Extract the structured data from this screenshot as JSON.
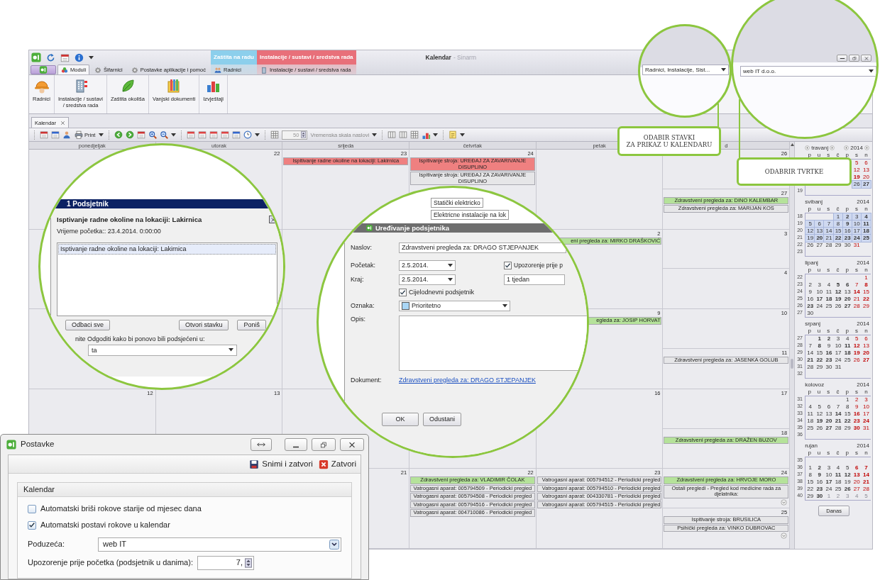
{
  "window": {
    "title": "Kalendar",
    "subtitle": "- Sinarm"
  },
  "ribbon_tabs": [
    {
      "label": "Moduli",
      "kind": "modules",
      "selected": true
    },
    {
      "label": "Šifarnici",
      "kind": "codebooks",
      "selected": false
    },
    {
      "label": "Postavke aplikacije i pomoć",
      "kind": "settings",
      "selected": false
    }
  ],
  "context_groups": [
    {
      "label": "Zaštita na radu",
      "color": "#8ccfec",
      "tab": {
        "label": "Radnici",
        "kind": "workers",
        "selected": false
      }
    },
    {
      "label": "Instalacije / sustavi / sredstva rada",
      "color": "#e8707a",
      "tab": {
        "label": "Instalacije / sustavi / sredstva rada",
        "kind": "installations",
        "selected": false
      }
    }
  ],
  "ribbon_buttons": [
    {
      "label": "Radnici",
      "kind": "workers"
    },
    {
      "label": "Instalacije / sustavi / sredstva rada",
      "kind": "installations"
    },
    {
      "label": "Zaštita okoliša",
      "kind": "environment"
    },
    {
      "label": "Vanjski dokumenti",
      "kind": "documents"
    },
    {
      "label": "Izvještaji",
      "kind": "reports"
    }
  ],
  "document_tabs": [
    {
      "label": "Kalendar",
      "selected": true
    }
  ],
  "toolbar": {
    "print": "Print",
    "scale_value": "50",
    "scale_label": "Vremenska skala naslovi"
  },
  "calendar": {
    "day_headers": [
      "ponedjeljak",
      "utorak",
      "srijeda",
      "četvrtak",
      "petak",
      "d"
    ],
    "weeks": [
      {
        "cells": [
          {
            "kind": "day"
          },
          {
            "kind": "day",
            "day": "22"
          },
          {
            "kind": "day",
            "day": "23",
            "events": [
              {
                "text": "Ispitivanje radne okoline na lokaciji: Lakirnica",
                "color": "#ef8080"
              }
            ]
          },
          {
            "kind": "day",
            "day": "24",
            "events": [
              {
                "text": "Ispitivanje stroja: UREĐAJ ZA ZAVARIVANJE DISUPLINO",
                "color": "#ef8080"
              },
              {
                "text": "Ispitivanje stroja: UREĐAJ ZA ZAVARIVANJE DISUPLINO",
                "color": "#e6e6e8"
              }
            ]
          },
          {
            "kind": "day"
          },
          {
            "kind": "weekend",
            "days": [
              {
                "day": "26"
              },
              {
                "day": "27",
                "events": [
                  {
                    "text": "Zdravstveni pregleda za: DINO KALEMBAR",
                    "color": "#b5e29a"
                  },
                  {
                    "text": "Zdravstveni pregleda za: MARIJAN KOS",
                    "color": "#e6e6e8"
                  }
                ]
              }
            ]
          }
        ]
      },
      {
        "cells": [
          {
            "kind": "day"
          },
          {
            "kind": "day"
          },
          {
            "kind": "day"
          },
          {
            "kind": "day"
          },
          {
            "kind": "day",
            "day": "2",
            "events": [
              {
                "text": "eni pregleda za: MIRKO DRAŠKOVIĆ",
                "color": "#b5e29a"
              }
            ]
          },
          {
            "kind": "weekend",
            "days": [
              {
                "day": "3"
              },
              {
                "day": "4"
              }
            ]
          }
        ]
      },
      {
        "cells": [
          {
            "kind": "day"
          },
          {
            "kind": "day"
          },
          {
            "kind": "day"
          },
          {
            "kind": "day"
          },
          {
            "kind": "day",
            "day": "9",
            "events": [
              {
                "text": "egleda za: JOSIP HORVAT",
                "color": "#b5e29a"
              }
            ]
          },
          {
            "kind": "weekend",
            "days": [
              {
                "day": "10"
              },
              {
                "day": "11",
                "events": [
                  {
                    "text": "Zdravstveni pregleda za: JASENKA GOLUB",
                    "color": "#e6e6e8"
                  }
                ]
              }
            ]
          }
        ]
      },
      {
        "cells": [
          {
            "kind": "day",
            "day": "12"
          },
          {
            "kind": "day",
            "day": "13"
          },
          {
            "kind": "day"
          },
          {
            "kind": "day"
          },
          {
            "kind": "day",
            "day": "16"
          },
          {
            "kind": "weekend",
            "days": [
              {
                "day": "17"
              },
              {
                "day": "18",
                "events": [
                  {
                    "text": "Zdravstveni pregleda za: DRAŽEN BUZOV",
                    "color": "#b5e29a"
                  }
                ]
              }
            ]
          }
        ]
      },
      {
        "cells": [
          {
            "kind": "day"
          },
          {
            "kind": "day"
          },
          {
            "kind": "day",
            "day": "21"
          },
          {
            "kind": "day",
            "day": "22",
            "events": [
              {
                "text": "Zdravstveni pregleda za: VLADIMIR ČOLAK",
                "color": "#b5e29a"
              },
              {
                "text": "Vatrogasni aparat: 005794509 - Periodicki pregled",
                "color": "#e6e6e8"
              },
              {
                "text": "Vatrogasni aparat: 005794508 - Periodicki pregled",
                "color": "#e6e6e8"
              },
              {
                "text": "Vatrogasni aparat: 005794516 - Periodicki pregled",
                "color": "#e6e6e8"
              },
              {
                "text": "Vatrogasni aparat: 004710086 - Periodicki pregled",
                "color": "#e6e6e8"
              }
            ]
          },
          {
            "kind": "day",
            "day": "23",
            "events": [
              {
                "text": "Vatrogasni aparat: 005794512 - Periodicki pregled",
                "color": "#e6e6e8"
              },
              {
                "text": "Vatrogasni aparat: 005794510 - Periodicki pregled",
                "color": "#e6e6e8"
              },
              {
                "text": "Vatrogasni aparat: 004330781 - Periodicki pregled",
                "color": "#e6e6e8"
              },
              {
                "text": "Vatrogasni aparat: 005794515 - Periodicki pregled",
                "color": "#e6e6e8"
              }
            ]
          },
          {
            "kind": "weekend",
            "days": [
              {
                "day": "24",
                "more": true,
                "events": [
                  {
                    "text": "Zdravstveni pregleda za: HRVOJE MORO",
                    "color": "#b5e29a"
                  },
                  {
                    "text": "Ostali pregledi - Pregled kod medicine rada za djelatnika:",
                    "color": "#e6e6e8"
                  }
                ]
              },
              {
                "day": "25",
                "more": true,
                "events": [
                  {
                    "text": "Ispitivanje stroja: BRUSILICA",
                    "color": "#e6e6e8"
                  },
                  {
                    "text": "Psihički pregleda za: VINKO DUBROVAC",
                    "color": "#e6e6e8"
                  }
                ]
              }
            ]
          }
        ]
      }
    ]
  },
  "mini_calendars": [
    {
      "name": "travanj",
      "year": "2014",
      "navigation": true,
      "weekdays": [
        "p",
        "u",
        "s",
        "č",
        "p",
        "s",
        "n"
      ],
      "weeks": [
        {
          "kind": "tail",
          "days": [
            "5",
            "6"
          ],
          "bold": [
            false,
            false
          ],
          "selected": false
        },
        {
          "kind": "tail",
          "days": [
            "12",
            "13"
          ],
          "bold": [
            false,
            false
          ],
          "selected": false
        },
        {
          "kind": "tail",
          "days": [
            "19",
            "20"
          ],
          "bold": [
            true,
            false
          ],
          "selected": false
        },
        {
          "kind": "tail",
          "days": [
            "26",
            "27"
          ],
          "bold": [
            false,
            true
          ],
          "selected": true
        },
        {
          "kind": "empty",
          "number": "19"
        }
      ]
    },
    {
      "name": "svibanj",
      "year": "2014",
      "weekdays": [
        "p",
        "u",
        "s",
        "č",
        "p",
        "s",
        "n"
      ],
      "weeks": [
        {
          "kind": "tail",
          "number": "18",
          "days": [
            "1",
            "2",
            "3",
            "4"
          ],
          "bold": [
            false,
            true,
            false,
            true
          ],
          "selected": true
        },
        {
          "kind": "full",
          "number": "19",
          "days": [
            "5",
            "6",
            "7",
            "8",
            "9",
            "10",
            "11"
          ],
          "bold": [
            false,
            false,
            false,
            false,
            true,
            false,
            true
          ],
          "selected": true
        },
        {
          "kind": "full",
          "number": "20",
          "days": [
            "12",
            "13",
            "14",
            "15",
            "16",
            "17",
            "18"
          ],
          "bold": [
            false,
            false,
            false,
            false,
            false,
            false,
            true
          ],
          "selected": true
        },
        {
          "kind": "full",
          "number": "21",
          "days": [
            "19",
            "20",
            "21",
            "22",
            "23",
            "24",
            "25"
          ],
          "bold": [
            false,
            true,
            false,
            true,
            true,
            true,
            true
          ],
          "selected": true
        },
        {
          "kind": "head",
          "number": "22",
          "days": [
            "26",
            "27",
            "28",
            "29",
            "30",
            "31"
          ],
          "bold": [
            false,
            false,
            false,
            false,
            false,
            false
          ],
          "selected": false
        },
        {
          "kind": "empty",
          "number": "23"
        }
      ]
    },
    {
      "name": "lipanj",
      "year": "2014",
      "weekdays": [
        "p",
        "u",
        "s",
        "č",
        "p",
        "s",
        "n"
      ],
      "weeks": [
        {
          "kind": "tail",
          "number": "22",
          "days": [
            "1"
          ],
          "bold": [
            false
          ],
          "selected": false
        },
        {
          "kind": "full",
          "number": "23",
          "days": [
            "2",
            "3",
            "4",
            "5",
            "6",
            "7",
            "8"
          ],
          "bold": [
            false,
            false,
            false,
            true,
            true,
            false,
            true
          ],
          "selected": false
        },
        {
          "kind": "full",
          "number": "24",
          "days": [
            "9",
            "10",
            "11",
            "12",
            "13",
            "14",
            "15"
          ],
          "bold": [
            false,
            false,
            false,
            true,
            false,
            true,
            false
          ],
          "selected": false
        },
        {
          "kind": "full",
          "number": "25",
          "days": [
            "16",
            "17",
            "18",
            "19",
            "20",
            "21",
            "22"
          ],
          "bold": [
            false,
            true,
            true,
            true,
            true,
            false,
            true
          ],
          "selected": false
        },
        {
          "kind": "full",
          "number": "26",
          "days": [
            "23",
            "24",
            "25",
            "26",
            "27",
            "28",
            "29"
          ],
          "bold": [
            true,
            false,
            false,
            false,
            true,
            false,
            false
          ],
          "selected": false
        },
        {
          "kind": "head",
          "number": "27",
          "days": [
            "30"
          ],
          "bold": [
            false
          ],
          "selected": false
        }
      ]
    },
    {
      "name": "srpanj",
      "year": "2014",
      "weekdays": [
        "p",
        "u",
        "s",
        "č",
        "p",
        "s",
        "n"
      ],
      "weeks": [
        {
          "kind": "tail",
          "number": "27",
          "days": [
            "1",
            "2",
            "3",
            "4",
            "5",
            "6"
          ],
          "bold": [
            true,
            true,
            false,
            false,
            false,
            false
          ],
          "selected": false
        },
        {
          "kind": "full",
          "number": "28",
          "days": [
            "7",
            "8",
            "9",
            "10",
            "11",
            "12",
            "13"
          ],
          "bold": [
            false,
            true,
            false,
            false,
            true,
            true,
            false
          ],
          "selected": false
        },
        {
          "kind": "full",
          "number": "29",
          "days": [
            "14",
            "15",
            "16",
            "17",
            "18",
            "19",
            "20"
          ],
          "bold": [
            false,
            false,
            true,
            false,
            true,
            true,
            true
          ],
          "selected": false
        },
        {
          "kind": "full",
          "number": "30",
          "days": [
            "21",
            "22",
            "23",
            "24",
            "25",
            "26",
            "27"
          ],
          "bold": [
            true,
            true,
            true,
            false,
            false,
            false,
            true
          ],
          "selected": false
        },
        {
          "kind": "head",
          "number": "31",
          "days": [
            "28",
            "29",
            "30",
            "31"
          ],
          "bold": [
            false,
            false,
            false,
            false
          ],
          "selected": false
        },
        {
          "kind": "empty",
          "number": "32"
        }
      ]
    },
    {
      "name": "kolovoz",
      "year": "2014",
      "weekdays": [
        "p",
        "u",
        "s",
        "č",
        "p",
        "s",
        "n"
      ],
      "weeks": [
        {
          "kind": "tail",
          "number": "31",
          "days": [
            "1",
            "2",
            "3"
          ],
          "bold": [
            false,
            false,
            false
          ],
          "selected": false
        },
        {
          "kind": "full",
          "number": "32",
          "days": [
            "4",
            "5",
            "6",
            "7",
            "8",
            "9",
            "10"
          ],
          "bold": [
            false,
            false,
            false,
            false,
            false,
            false,
            false
          ],
          "selected": false
        },
        {
          "kind": "full",
          "number": "33",
          "days": [
            "11",
            "12",
            "13",
            "14",
            "15",
            "16",
            "17"
          ],
          "bold": [
            false,
            false,
            false,
            true,
            false,
            true,
            false
          ],
          "selected": false
        },
        {
          "kind": "full",
          "number": "34",
          "days": [
            "18",
            "19",
            "20",
            "21",
            "22",
            "23",
            "24"
          ],
          "bold": [
            false,
            true,
            true,
            true,
            true,
            true,
            true
          ],
          "selected": false
        },
        {
          "kind": "full",
          "number": "35",
          "days": [
            "25",
            "26",
            "27",
            "28",
            "29",
            "30",
            "31"
          ],
          "bold": [
            false,
            false,
            true,
            false,
            false,
            true,
            false
          ],
          "selected": false
        },
        {
          "kind": "empty",
          "number": "36"
        }
      ]
    },
    {
      "name": "rujan",
      "year": "2014",
      "weekdays": [
        "p",
        "u",
        "s",
        "č",
        "p",
        "s",
        "n"
      ],
      "weeks": [
        {
          "kind": "empty",
          "number": "35"
        },
        {
          "kind": "full",
          "number": "36",
          "days": [
            "1",
            "2",
            "3",
            "4",
            "5",
            "6",
            "7"
          ],
          "bold": [
            false,
            true,
            false,
            false,
            false,
            true,
            true
          ],
          "selected": false
        },
        {
          "kind": "full",
          "number": "37",
          "days": [
            "8",
            "9",
            "10",
            "11",
            "12",
            "13",
            "14"
          ],
          "bold": [
            false,
            true,
            false,
            true,
            true,
            true,
            true
          ],
          "selected": false
        },
        {
          "kind": "full",
          "number": "38",
          "days": [
            "15",
            "16",
            "17",
            "18",
            "19",
            "20",
            "21"
          ],
          "bold": [
            false,
            false,
            true,
            false,
            false,
            false,
            true
          ],
          "selected": false
        },
        {
          "kind": "full",
          "number": "39",
          "days": [
            "22",
            "23",
            "24",
            "25",
            "26",
            "27",
            "28"
          ],
          "bold": [
            false,
            true,
            false,
            false,
            true,
            false,
            false
          ],
          "selected": false
        },
        {
          "kind": "full",
          "number": "40",
          "days": [
            "29",
            "30",
            "1",
            "2",
            "3",
            "4",
            "5"
          ],
          "bold": [
            false,
            true,
            false,
            false,
            false,
            false,
            false
          ],
          "muted": [
            false,
            false,
            true,
            true,
            true,
            true,
            true
          ],
          "selected": false
        }
      ]
    }
  ],
  "today_button": "Danas",
  "zoom_filter": {
    "value": "Radnici, Instalacije, Sist..."
  },
  "zoom_company": {
    "value": "web IT d.o.o."
  },
  "callouts": [
    {
      "lines": [
        "ODABIR STAVKI",
        "ZA PRIKAZ U KALENDARU"
      ]
    },
    {
      "lines": [
        "ODABRIR TVRTKE"
      ]
    }
  ],
  "reminder_dialog": {
    "title": "1 Podsjetnik",
    "heading": "Isptivanje radne okoline na lokaciji: Lakirnica",
    "start": "Vrijeme početka:: 23.4.2014. 0:00:00",
    "items": [
      {
        "text": "Isptivanje radne okoline na lokaciji: Lakirnica",
        "selected": true
      }
    ],
    "buttons": [
      "Odbaci sve",
      "Otvori stavku",
      "Poniš"
    ],
    "snooze_label": "nite Odgoditi kako bi ponovo bili podsjećeni u:",
    "snooze_value": "ta"
  },
  "edit_dialog": {
    "fragments": [
      "Statički elektricko",
      "Elektricne instalacije na lok"
    ],
    "title": "Uređivanje podsjetnika",
    "subject_label": "Naslov:",
    "subject": "Zdravstveni pregleda za: DRAGO STJEPANJEK",
    "start_label": "Početak:",
    "start": "2.5.2014.",
    "warning": {
      "label": "Upozorenje prije p",
      "checked": true
    },
    "end_label": "Kraj:",
    "end": "2.5.2014.",
    "warning_value": "1 tjedan",
    "all_day": {
      "label": "Cijelodnevni podsjetnik",
      "checked": true
    },
    "tag_label": "Oznaka:",
    "tag": {
      "label": "Prioritetno",
      "color": "#a9d6f5"
    },
    "description_label": "Opis:",
    "document_label": "Dokument:",
    "document_link": "Zdravstveni pregleda za: DRAGO STJEPANJEK",
    "buttons": [
      "OK",
      "Odustani"
    ]
  },
  "settings_window": {
    "title": "Postavke",
    "actions": [
      {
        "label": "Snimi i zatvori",
        "kind": "save"
      },
      {
        "label": "Zatvori",
        "kind": "close"
      }
    ],
    "group": "Kalendar",
    "options": [
      {
        "label": "Automatski briši rokove starije od mjesec dana",
        "checked": false
      },
      {
        "label": "Automatski postavi rokove u kalendar",
        "checked": true
      }
    ],
    "company_label": "Poduzeća:",
    "company_value": "web IT",
    "warning_label": "Upozorenje prije početka (podsjetnik u danima):",
    "warning_value": "7,"
  }
}
